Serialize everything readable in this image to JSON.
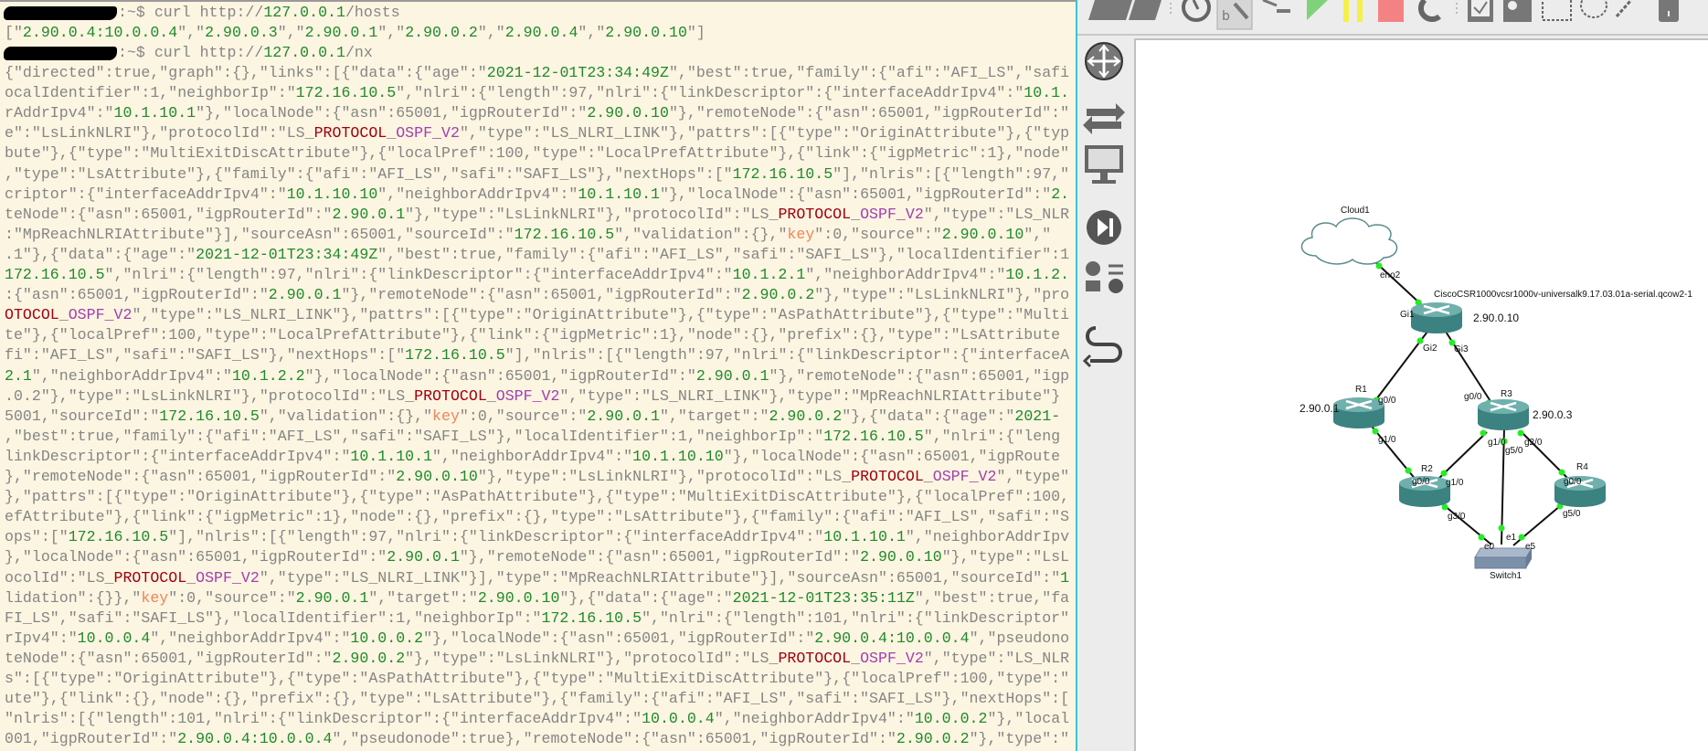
{
  "terminal": {
    "prompt_suffix": ":~$ ",
    "commands": [
      {
        "command": "curl http://127.0.0.1/hosts"
      },
      {
        "command": "curl http://127.0.0.1/nx"
      }
    ],
    "hosts_output": "[\"2.90.0.4:10.0.0.4\",\"2.90.0.3\",\"2.90.0.1\",\"2.90.0.2\",\"2.90.0.4\",\"2.90.0.10\"]",
    "nx_output_lines": [
      "{\"directed\":true,\"graph\":{},\"links\":[{\"data\":{\"age\":\"2021-12-01T23:34:49Z\",\"best\":true,\"family\":{\"afi\":\"AFI_LS\",\"safi",
      "ocalIdentifier\":1,\"neighborIp\":\"172.16.10.5\",\"nlri\":{\"length\":97,\"nlri\":{\"linkDescriptor\":{\"interfaceAddrIpv4\":\"10.1.",
      "rAddrIpv4\":\"10.1.10.1\"},\"localNode\":{\"asn\":65001,\"igpRouterId\":\"2.90.0.10\"},\"remoteNode\":{\"asn\":65001,\"igpRouterId\":\"",
      "e\":\"LsLinkNLRI\"},\"protocolId\":\"LS_PROTOCOL_OSPF_V2\",\"type\":\"LS_NLRI_LINK\"},\"pattrs\":[{\"type\":\"OriginAttribute\"},{\"typ",
      "bute\"},{\"type\":\"MultiExitDiscAttribute\"},{\"localPref\":100,\"type\":\"LocalPrefAttribute\"},{\"link\":{\"igpMetric\":1},\"node\"",
      ",\"type\":\"LsAttribute\"},{\"family\":{\"afi\":\"AFI_LS\",\"safi\":\"SAFI_LS\"},\"nextHops\":[\"172.16.10.5\"],\"nlris\":[{\"length\":97,\"",
      "criptor\":{\"interfaceAddrIpv4\":\"10.1.10.10\",\"neighborAddrIpv4\":\"10.1.10.1\"},\"localNode\":{\"asn\":65001,\"igpRouterId\":\"2.",
      "teNode\":{\"asn\":65001,\"igpRouterId\":\"2.90.0.1\"},\"type\":\"LsLinkNLRI\"},\"protocolId\":\"LS_PROTOCOL_OSPF_V2\",\"type\":\"LS_NLR",
      ":\"MpReachNLRIAttribute\"}],\"sourceAsn\":65001,\"sourceId\":\"172.16.10.5\",\"validation\":{},\"key\":0,\"source\":\"2.90.0.10\",\"",
      ".1\"},{\"data\":{\"age\":\"2021-12-01T23:34:49Z\",\"best\":true,\"family\":{\"afi\":\"AFI_LS\",\"safi\":\"SAFI_LS\"},\"localIdentifier\":1",
      "172.16.10.5\",\"nlri\":{\"length\":97,\"nlri\":{\"linkDescriptor\":{\"interfaceAddrIpv4\":\"10.1.2.1\",\"neighborAddrIpv4\":\"10.1.2.",
      ":{\"asn\":65001,\"igpRouterId\":\"2.90.0.1\"},\"remoteNode\":{\"asn\":65001,\"igpRouterId\":\"2.90.0.2\"},\"type\":\"LsLinkNLRI\"},\"pro",
      "OTOCOL_OSPF_V2\",\"type\":\"LS_NLRI_LINK\"},\"pattrs\":[{\"type\":\"OriginAttribute\"},{\"type\":\"AsPathAttribute\"},{\"type\":\"Multi",
      "te\"},{\"localPref\":100,\"type\":\"LocalPrefAttribute\"},{\"link\":{\"igpMetric\":1},\"node\":{},\"prefix\":{},\"type\":\"LsAttribute",
      "fi\":\"AFI_LS\",\"safi\":\"SAFI_LS\"},\"nextHops\":[\"172.16.10.5\"],\"nlris\":[{\"length\":97,\"nlri\":{\"linkDescriptor\":{\"interfaceA",
      "2.1\",\"neighborAddrIpv4\":\"10.1.2.2\"},\"localNode\":{\"asn\":65001,\"igpRouterId\":\"2.90.0.1\"},\"remoteNode\":{\"asn\":65001,\"igp",
      ".0.2\"},\"type\":\"LsLinkNLRI\"},\"protocolId\":\"LS_PROTOCOL_OSPF_V2\",\"type\":\"LS_NLRI_LINK\"},\"type\":\"MpReachNLRIAttribute\"}",
      "5001,\"sourceId\":\"172.16.10.5\",\"validation\":{},\"key\":0,\"source\":\"2.90.0.1\",\"target\":\"2.90.0.2\"},{\"data\":{\"age\":\"2021-",
      ",\"best\":true,\"family\":{\"afi\":\"AFI_LS\",\"safi\":\"SAFI_LS\"},\"localIdentifier\":1,\"neighborIp\":\"172.16.10.5\",\"nlri\":{\"leng",
      "linkDescriptor\":{\"interfaceAddrIpv4\":\"10.1.10.1\",\"neighborAddrIpv4\":\"10.1.10.10\"},\"localNode\":{\"asn\":65001,\"igpRoute",
      "},\"remoteNode\":{\"asn\":65001,\"igpRouterId\":\"2.90.0.10\"},\"type\":\"LsLinkNLRI\"},\"protocolId\":\"LS_PROTOCOL_OSPF_V2\",\"type\"",
      "},\"pattrs\":[{\"type\":\"OriginAttribute\"},{\"type\":\"AsPathAttribute\"},{\"type\":\"MultiExitDiscAttribute\"},{\"localPref\":100,",
      "efAttribute\"},{\"link\":{\"igpMetric\":1},\"node\":{},\"prefix\":{},\"type\":\"LsAttribute\"},{\"family\":{\"afi\":\"AFI_LS\",\"safi\":\"S",
      "ops\":[\"172.16.10.5\"],\"nlris\":[{\"length\":97,\"nlri\":{\"linkDescriptor\":{\"interfaceAddrIpv4\":\"10.1.10.1\",\"neighborAddrIpv",
      "},\"localNode\":{\"asn\":65001,\"igpRouterId\":\"2.90.0.1\"},\"remoteNode\":{\"asn\":65001,\"igpRouterId\":\"2.90.0.10\"},\"type\":\"LsL",
      "ocolId\":\"LS_PROTOCOL_OSPF_V2\",\"type\":\"LS_NLRI_LINK\"}],\"type\":\"MpReachNLRIAttribute\"}],\"sourceAsn\":65001,\"sourceId\":\"1",
      "lidation\":{}},\"key\":0,\"source\":\"2.90.0.1\",\"target\":\"2.90.0.10\"},{\"data\":{\"age\":\"2021-12-01T23:35:11Z\",\"best\":true,\"fa",
      "FI_LS\",\"safi\":\"SAFI_LS\"},\"localIdentifier\":1,\"neighborIp\":\"172.16.10.5\",\"nlri\":{\"length\":101,\"nlri\":{\"linkDescriptor\"",
      "rIpv4\":\"10.0.0.4\",\"neighborAddrIpv4\":\"10.0.0.2\"},\"localNode\":{\"asn\":65001,\"igpRouterId\":\"2.90.0.4:10.0.0.4\",\"pseudono",
      "teNode\":{\"asn\":65001,\"igpRouterId\":\"2.90.0.2\"},\"type\":\"LsLinkNLRI\"},\"protocolId\":\"LS_PROTOCOL_OSPF_V2\",\"type\":\"LS_NLR",
      "s\":[{\"type\":\"OriginAttribute\"},{\"type\":\"AsPathAttribute\"},{\"type\":\"MultiExitDiscAttribute\"},{\"localPref\":100,\"type\":\"",
      "ute\"},{\"link\":{},\"node\":{},\"prefix\":{},\"type\":\"LsAttribute\"},{\"family\":{\"afi\":\"AFI_LS\",\"safi\":\"SAFI_LS\"},\"nextHops\":[",
      "\"nlris\":[{\"length\":101,\"nlri\":{\"linkDescriptor\":{\"interfaceAddrIpv4\":\"10.0.0.4\",\"neighborAddrIpv4\":\"10.0.0.2\"},\"local",
      "001,\"igpRouterId\":\"2.90.0.4:10.0.0.4\",\"pseudonode\":true},\"remoteNode\":{\"asn\":65001,\"igpRouterId\":\"2.90.0.2\"},\"type\":\"",
      "protocolId\":\"LS_PROTOCOL_OSPF_V2\",\"type\":\"LS_NLRI_LINK\"}],\"type\":\"MpReachNLRIAttribute\"}],\"sourceAsn\":65001,\"sourceId\":\"172.1"
    ]
  },
  "gns3": {
    "toolbar_icons": [
      "folder-icon",
      "save-icon",
      "clock-icon",
      "console-all-icon",
      "terminal-icon",
      "start-icon",
      "suspend-icon",
      "stop-icon",
      "reload-icon",
      "note-icon",
      "image-icon",
      "rectangle-icon",
      "ellipse-icon",
      "line-icon",
      "lock-icon"
    ],
    "colors": {
      "start": "#7fd27a",
      "suspend": "#f5ef4a",
      "stop": "#f58282",
      "link_up": "#22ee22",
      "router": "#3e8a88"
    },
    "device_panel_icons": [
      "routers-icon",
      "switches-icon",
      "end-devices-icon",
      "security-devices-icon",
      "all-devices-icon",
      "add-link-icon"
    ],
    "nodes": {
      "cloud": {
        "name": "Cloud1"
      },
      "csr": {
        "name": "CiscoCSR1000vcsr1000v-universalk9.17.03.01a-serial.qcow2-1",
        "ip": "2.90.0.10"
      },
      "r1": {
        "name": "R1",
        "ip": "2.90.0.1"
      },
      "r2": {
        "name": "R2"
      },
      "r3": {
        "name": "R3",
        "ip": "2.90.0.3"
      },
      "r4": {
        "name": "R4"
      },
      "switch": {
        "name": "Switch1"
      }
    },
    "interfaces": {
      "cloud_eno2": "eno2",
      "csr_gi1": "Gi1",
      "csr_gi2": "Gi2",
      "csr_gi3": "Gi3",
      "r1_g00": "g0/0",
      "r1_g10": "g1/0",
      "r3_g00": "g0/0",
      "r3_g10": "g1/0",
      "r3_g50": "g5/0",
      "r3_g20": "g2/0",
      "r2_g00": "g0/0",
      "r2_g10": "g1/0",
      "r2_g30": "g3/0",
      "r4_g00": "g0/0",
      "r4_g50": "g5/0",
      "sw_e0": "e0",
      "sw_e1": "e1",
      "sw_e5": "e5"
    }
  }
}
